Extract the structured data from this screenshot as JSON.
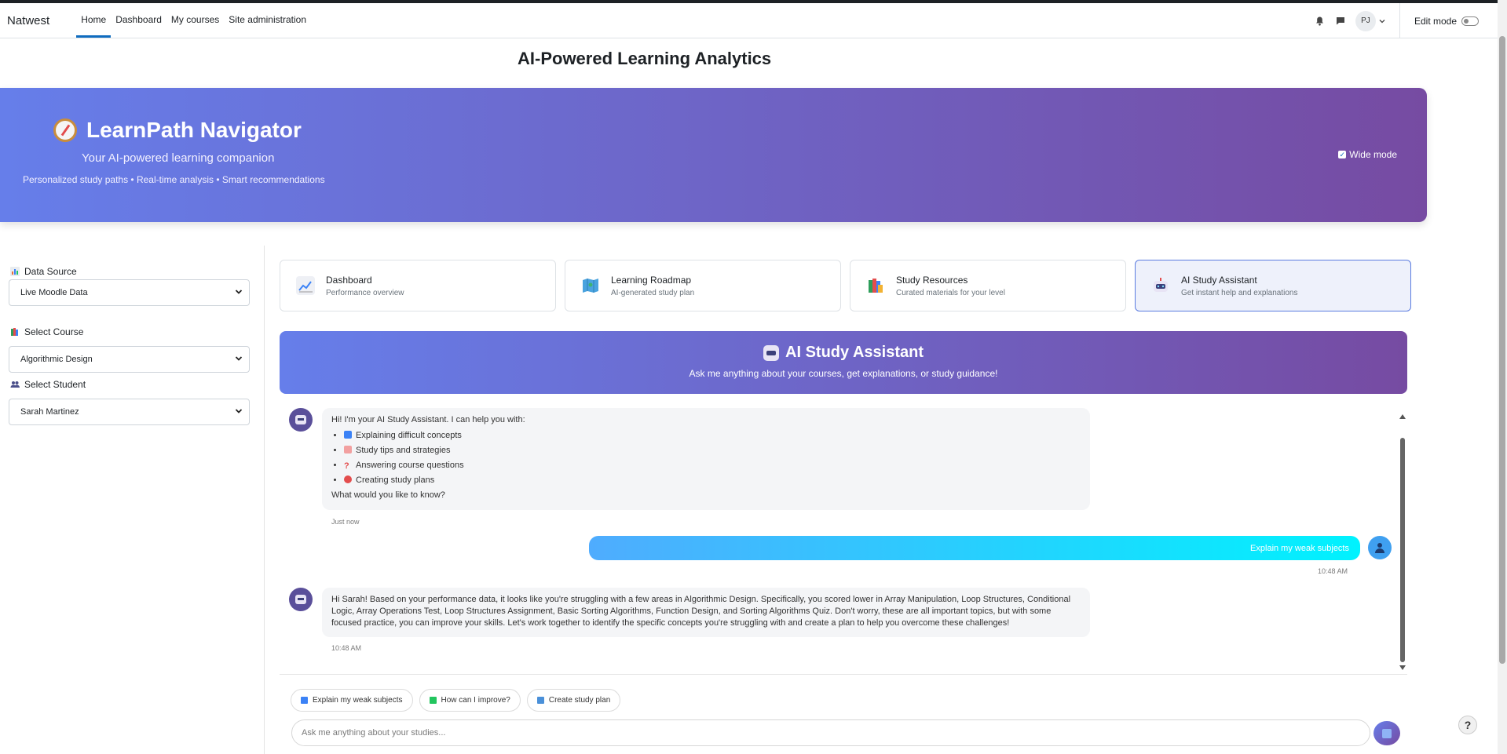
{
  "topbar": {
    "brand": "Natwest",
    "nav": [
      "Home",
      "Dashboard",
      "My courses",
      "Site administration"
    ],
    "avatar_initials": "PJ",
    "edit_mode_label": "Edit mode"
  },
  "page_title": "AI-Powered Learning Analytics",
  "hero": {
    "title": "LearnPath Navigator",
    "subtitle": "Your AI-powered learning companion",
    "tagline": "Personalized study paths • Real-time analysis • Smart recommendations",
    "wide_mode_label": "Wide mode",
    "wide_mode_checked": true
  },
  "sidebar": {
    "data_source_label": "Data Source",
    "data_source_value": "Live Moodle Data",
    "course_label": "Select Course",
    "course_value": "Algorithmic Design",
    "student_label": "Select Student",
    "student_value": "Sarah Martinez"
  },
  "tabs": [
    {
      "title": "Dashboard",
      "desc": "Performance overview",
      "icon": "chart-icon"
    },
    {
      "title": "Learning Roadmap",
      "desc": "AI-generated study plan",
      "icon": "map-icon"
    },
    {
      "title": "Study Resources",
      "desc": "Curated materials for your level",
      "icon": "books-icon"
    },
    {
      "title": "AI Study Assistant",
      "desc": "Get instant help and explanations",
      "icon": "robot-icon"
    }
  ],
  "banner": {
    "title": "AI Study Assistant",
    "subtitle": "Ask me anything about your courses, get explanations, or study guidance!"
  },
  "chat": {
    "intro": "Hi! I'm your AI Study Assistant. I can help you with:",
    "intro_items": [
      "Explaining difficult concepts",
      "Study tips and strategies",
      "Answering course questions",
      "Creating study plans"
    ],
    "intro_outro": "What would you like to know?",
    "intro_time": "Just now",
    "user_message": "Explain my weak subjects",
    "user_time": "10:48 AM",
    "reply": "Hi Sarah! Based on your performance data, it looks like you're struggling with a few areas in Algorithmic Design. Specifically, you scored lower in Array Manipulation, Loop Structures, Conditional Logic, Array Operations Test, Loop Structures Assignment, Basic Sorting Algorithms, Function Design, and Sorting Algorithms Quiz. Don't worry, these are all important topics, but with some focused practice, you can improve your skills. Let's work together to identify the specific concepts you're struggling with and create a plan to help you overcome these challenges!",
    "reply_time": "10:48 AM"
  },
  "quick_actions": [
    "Explain my weak subjects",
    "How can I improve?",
    "Create study plan"
  ],
  "input": {
    "placeholder": "Ask me anything about your studies..."
  },
  "help_label": "?"
}
